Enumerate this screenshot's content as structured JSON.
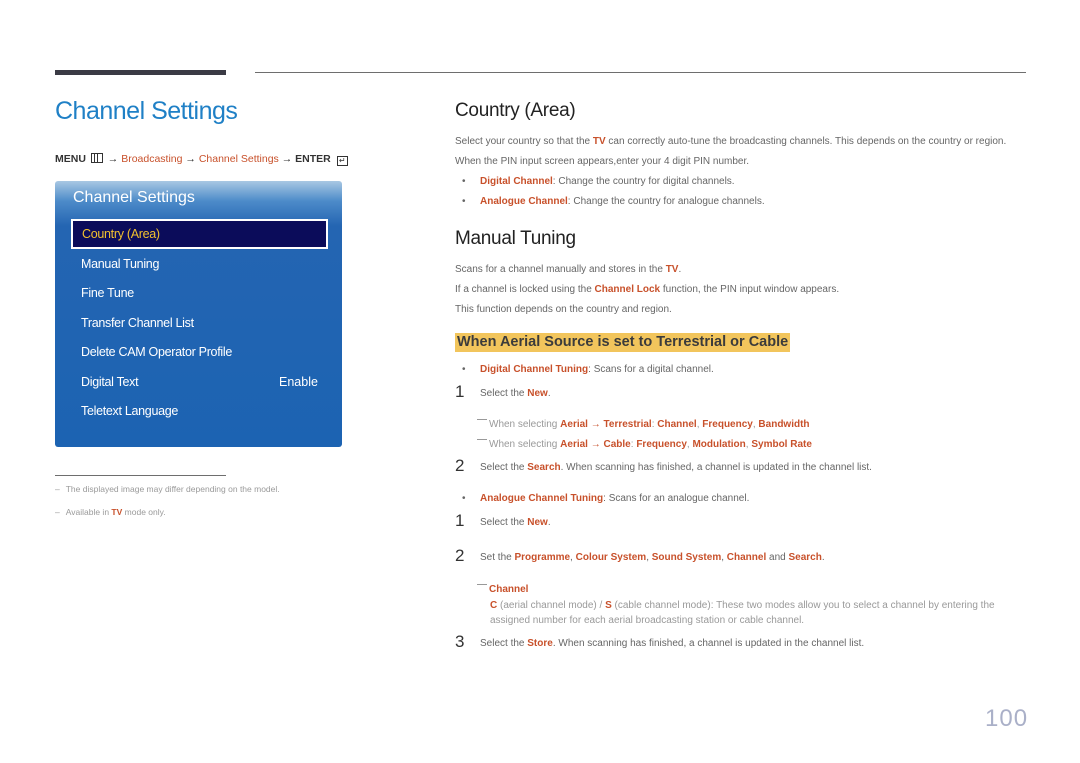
{
  "page": {
    "title": "Channel Settings",
    "page_number": "100"
  },
  "breadcrumb": {
    "menu": "MENU",
    "menu_icon": "menu-grid-icon",
    "arrow": "→",
    "path1": "Broadcasting",
    "path2": "Channel Settings",
    "enter": "ENTER",
    "enter_icon": "enter-icon"
  },
  "osd": {
    "title": "Channel Settings",
    "selected_item": "Country (Area)",
    "items": [
      {
        "label": "Manual Tuning",
        "value": ""
      },
      {
        "label": "Fine Tune",
        "value": ""
      },
      {
        "label": "Transfer Channel List",
        "value": ""
      },
      {
        "label": "Delete CAM Operator Profile",
        "value": ""
      },
      {
        "label": "Digital Text",
        "value": "Enable"
      },
      {
        "label": "Teletext Language",
        "value": ""
      }
    ],
    "colors": {
      "panel": "#1c63b2",
      "selected_bg": "#0b0c5a",
      "selected_text": "#f2c12e"
    }
  },
  "footnotes": [
    {
      "dash": "–",
      "text": "The displayed image may differ depending on the model."
    },
    {
      "dash": "–",
      "pre": "Available in ",
      "hl": "TV",
      "post": " mode only."
    }
  ],
  "country": {
    "heading": "Country (Area)",
    "p1_pre": "Select your country so that the ",
    "p1_hl": "TV",
    "p1_post": " can correctly auto-tune the broadcasting channels. This depends on the country or region.",
    "p2": "When the PIN input screen appears,enter your 4 digit PIN number.",
    "bullets": [
      {
        "hl": "Digital Channel",
        "text": ": Change the country for digital channels."
      },
      {
        "hl": "Analogue Channel",
        "text": ": Change the country for analogue channels."
      }
    ]
  },
  "manual": {
    "heading": "Manual Tuning",
    "p1_pre": "Scans for a channel manually and stores in the ",
    "p1_hl": "TV",
    "p1_post": ".",
    "p2_pre": "If a channel is locked using the ",
    "p2_hl": "Channel Lock",
    "p2_post": " function, the PIN input window appears.",
    "p3": "This function depends on the country and region.",
    "subheading": "When Aerial Source is set to Terrestrial or Cable",
    "digital": {
      "hl": "Digital Channel Tuning",
      "text": ": Scans for a digital channel.",
      "step1_num": "1",
      "step1_pre": "Select the ",
      "step1_hl": "New",
      "step1_post": ".",
      "note1": {
        "pre": "When selecting ",
        "a": "Aerial",
        "arrow": " → ",
        "b": "Terrestrial",
        "sep": ": ",
        "c": "Channel",
        "d": "Frequency",
        "e": "Bandwidth"
      },
      "note2": {
        "pre": "When selecting ",
        "a": "Aerial",
        "arrow": " → ",
        "b": "Cable",
        "sep": ": ",
        "c": "Frequency",
        "d": "Modulation",
        "e": "Symbol Rate"
      },
      "step2_num": "2",
      "step2_pre": "Select the ",
      "step2_hl": "Search",
      "step2_post": ". When scanning has finished, a channel is updated in the channel list."
    },
    "analogue": {
      "hl": "Analogue Channel Tuning",
      "text": ": Scans for an analogue channel.",
      "step1_num": "1",
      "step1_pre": "Select the ",
      "step1_hl": "New",
      "step1_post": ".",
      "step2_num": "2",
      "step2_pre": "Set the ",
      "step2_a": "Programme",
      "step2_b": "Colour System",
      "step2_c": "Sound System",
      "step2_d": "Channel",
      "step2_and": " and ",
      "step2_e": "Search",
      "note_title": "Channel",
      "note_c": "C",
      "note_c_text": " (aerial channel mode) / ",
      "note_s": "S",
      "note_s_text": " (cable channel mode): These two modes allow you to select a channel by entering the",
      "note_line2": "assigned number for each aerial broadcasting station or cable channel.",
      "step3_num": "3",
      "step3_pre": "Select the ",
      "step3_hl": "Store",
      "step3_post": ". When scanning has finished, a channel is updated in the channel list."
    }
  },
  "colors": {
    "title_blue": "#1f80c6",
    "highlight_orange": "#c8512b",
    "subheading_bg": "#f2c55c"
  }
}
